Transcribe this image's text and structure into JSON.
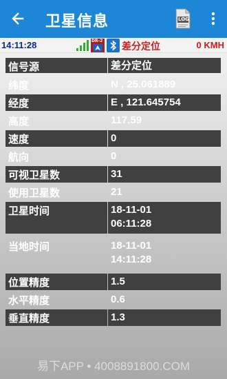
{
  "appbar": {
    "title": "卫星信息",
    "log_label": "LOG",
    "color": "#1e86d6"
  },
  "status": {
    "time": "14:11:28",
    "dr_label": "DR-2",
    "fix_mode": "差分定位",
    "speed": "0 KMH"
  },
  "rows": [
    {
      "label": "信号源",
      "value": "差分定位"
    },
    {
      "label": "纬度",
      "value": "N , 25.061889"
    },
    {
      "label": "经度",
      "value": "E , 121.645754"
    },
    {
      "label": "高度",
      "value": "117.59"
    },
    {
      "label": "速度",
      "value": "0"
    },
    {
      "label": "航向",
      "value": "0"
    },
    {
      "label": "可视卫星数",
      "value": "31"
    },
    {
      "label": "使用卫星数",
      "value": "21"
    },
    {
      "label": "卫星时间",
      "value": "18-11-01\n06:11:28"
    },
    {
      "label": "当地时间",
      "value": "18-11-01\n14:11:28"
    },
    {
      "label": "位置精度",
      "value": "1.5"
    },
    {
      "label": "水平精度",
      "value": "0.6"
    },
    {
      "label": "垂直精度",
      "value": "1.3"
    }
  ],
  "watermark": "易下APP • 4008891800.COM"
}
